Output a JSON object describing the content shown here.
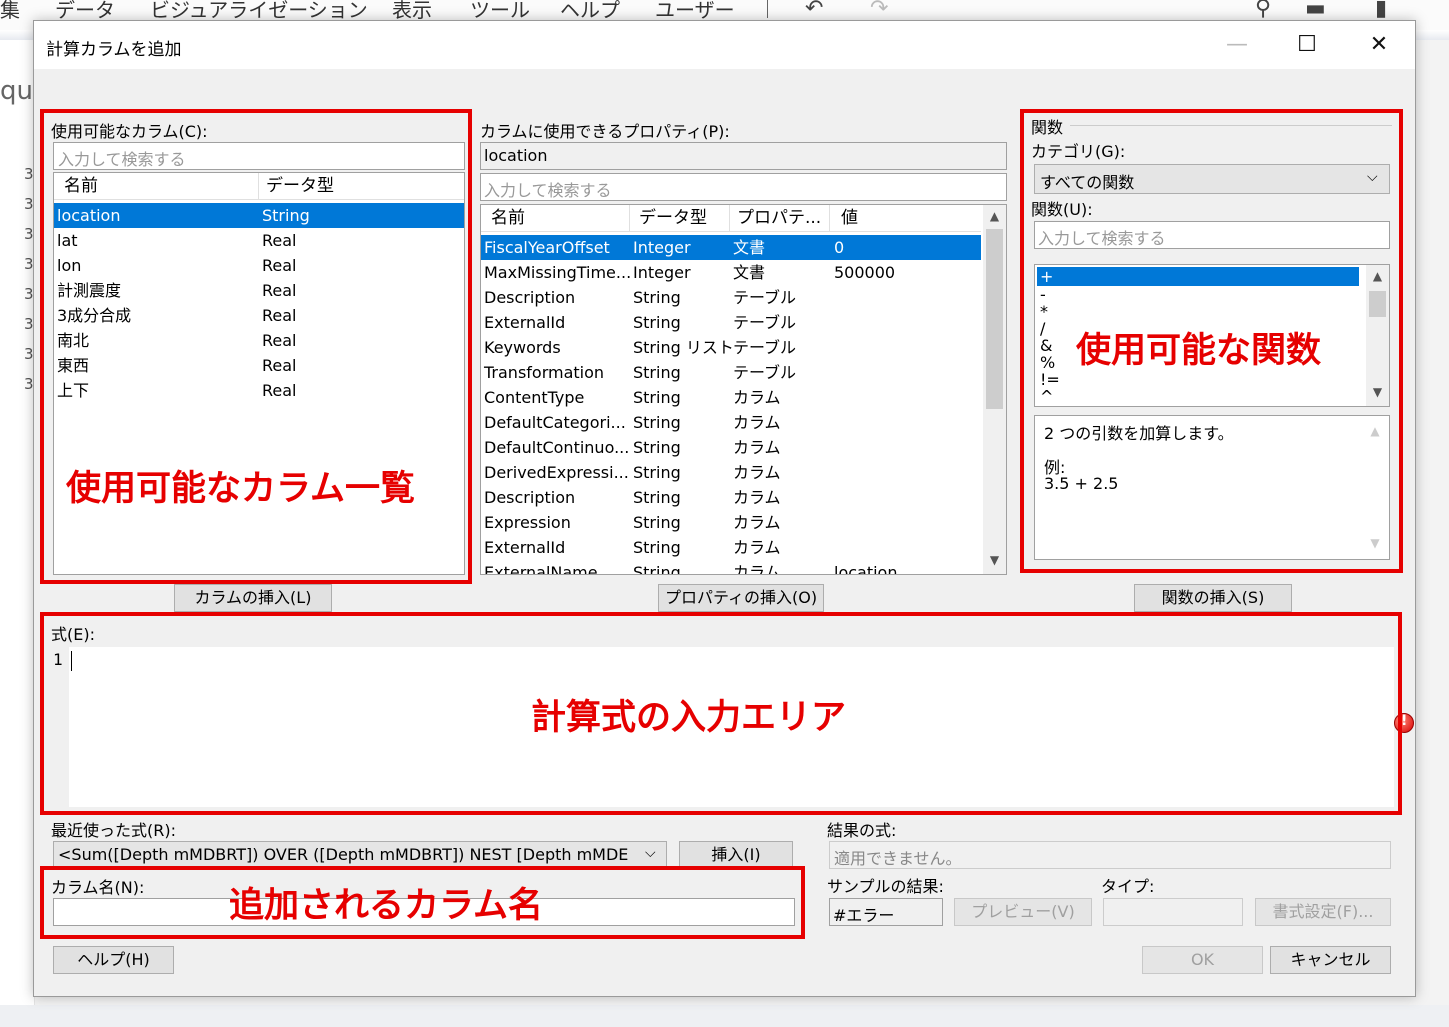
{
  "app_menu": {
    "items": [
      "集",
      "データ",
      "ビジュアライゼーション",
      "表示",
      "ツール",
      "ヘルプ",
      "ユーザー"
    ],
    "bg_left_text": "qua",
    "bg_left_rows": [
      "3",
      "3",
      "3",
      "3",
      "3",
      "3",
      "3",
      "3"
    ]
  },
  "dialog": {
    "title": "計算カラムを追加",
    "minimize": "—",
    "maximize": "☐",
    "close": "✕"
  },
  "columns_panel": {
    "label": "使用可能なカラム(C):",
    "search_placeholder": "入力して検索する",
    "headers": [
      "名前",
      "データ型"
    ],
    "rows": [
      {
        "name": "location",
        "type": "String"
      },
      {
        "name": "lat",
        "type": "Real"
      },
      {
        "name": "lon",
        "type": "Real"
      },
      {
        "name": "計測震度",
        "type": "Real"
      },
      {
        "name": "3成分合成",
        "type": "Real"
      },
      {
        "name": "南北",
        "type": "Real"
      },
      {
        "name": "東西",
        "type": "Real"
      },
      {
        "name": "上下",
        "type": "Real"
      }
    ],
    "insert_button": "カラムの挿入(L)"
  },
  "properties_panel": {
    "label": "カラムに使用できるプロパティ(P):",
    "selected_column": "location",
    "search_placeholder": "入力して検索する",
    "headers": [
      "名前",
      "データ型",
      "プロパテ...",
      "値"
    ],
    "rows": [
      {
        "name": "FiscalYearOffset",
        "type": "Integer",
        "prop": "文書",
        "value": "0"
      },
      {
        "name": "MaxMissingTime...",
        "type": "Integer",
        "prop": "文書",
        "value": "500000"
      },
      {
        "name": "Description",
        "type": "String",
        "prop": "テーブル",
        "value": ""
      },
      {
        "name": "ExternalId",
        "type": "String",
        "prop": "テーブル",
        "value": ""
      },
      {
        "name": "Keywords",
        "type": "String リスト",
        "prop": "テーブル",
        "value": ""
      },
      {
        "name": "Transformation",
        "type": "String",
        "prop": "テーブル",
        "value": ""
      },
      {
        "name": "ContentType",
        "type": "String",
        "prop": "カラム",
        "value": ""
      },
      {
        "name": "DefaultCategori...",
        "type": "String",
        "prop": "カラム",
        "value": ""
      },
      {
        "name": "DefaultContinuo...",
        "type": "String",
        "prop": "カラム",
        "value": ""
      },
      {
        "name": "DerivedExpressi...",
        "type": "String",
        "prop": "カラム",
        "value": ""
      },
      {
        "name": "Description",
        "type": "String",
        "prop": "カラム",
        "value": ""
      },
      {
        "name": "Expression",
        "type": "String",
        "prop": "カラム",
        "value": ""
      },
      {
        "name": "ExternalId",
        "type": "String",
        "prop": "カラム",
        "value": ""
      },
      {
        "name": "ExternalName",
        "type": "String",
        "prop": "カラム",
        "value": "location"
      }
    ],
    "insert_button": "プロパティの挿入(O)"
  },
  "functions_panel": {
    "group_label": "関数",
    "category_label": "カテゴリ(G):",
    "category_value": "すべての関数",
    "function_label": "関数(U):",
    "search_placeholder": "入力して検索する",
    "functions": [
      "+",
      "-",
      "*",
      "/",
      "&",
      "%",
      "!=",
      "^"
    ],
    "description_line1": "2 つの引数を加算します。",
    "description_line2": "例:",
    "description_line3": "3.5 + 2.5",
    "insert_button": "関数の挿入(S)"
  },
  "expression": {
    "label": "式(E):",
    "line_number": "1"
  },
  "recent": {
    "label": "最近使った式(R):",
    "value": "<Sum([Depth mMDBRT]) OVER ([Depth mMDBRT]) NEST [Depth mMDE",
    "insert_button": "挿入(I)"
  },
  "result": {
    "label": "結果の式:",
    "value": "適用できません。",
    "sample_label": "サンプルの結果:",
    "sample_value": "#エラー",
    "preview_button": "プレビュー(V)",
    "type_label": "タイプ:",
    "format_button": "書式設定(F)..."
  },
  "column_name": {
    "label": "カラム名(N):",
    "value": ""
  },
  "footer": {
    "help_button": "ヘルプ(H)",
    "ok_button": "OK",
    "cancel_button": "キャンセル"
  },
  "annotations": {
    "columns": "使用可能なカラム一覧",
    "functions": "使用可能な関数",
    "expression": "計算式の入力エリア",
    "column_name": "追加されるカラム名"
  },
  "colors": {
    "selection": "#0078d7",
    "annotation_red": "#e60000"
  }
}
